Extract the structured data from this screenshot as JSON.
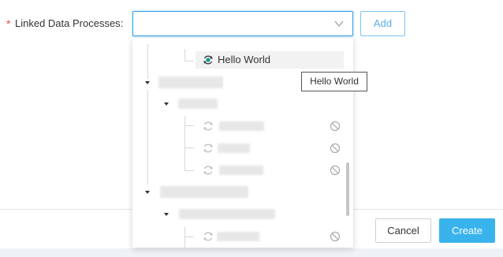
{
  "form": {
    "required_mark": "*",
    "label": "Linked Data Processes",
    "label_colon": ":",
    "select_value": "",
    "add_label": "Add"
  },
  "tree": {
    "selected_node_label": "Hello World"
  },
  "tooltip": {
    "text": "Hello World"
  },
  "footer": {
    "cancel_label": "Cancel",
    "create_label": "Create"
  },
  "colors": {
    "accent": "#39b3ec",
    "required": "#e5484d",
    "node_running_icon": "#0a9e8a"
  },
  "icons": {
    "dropdown": "chevron-down-icon",
    "node_status": "sync-icon",
    "node_disabled": "ban-icon",
    "collapse": "caret-down-icon"
  }
}
